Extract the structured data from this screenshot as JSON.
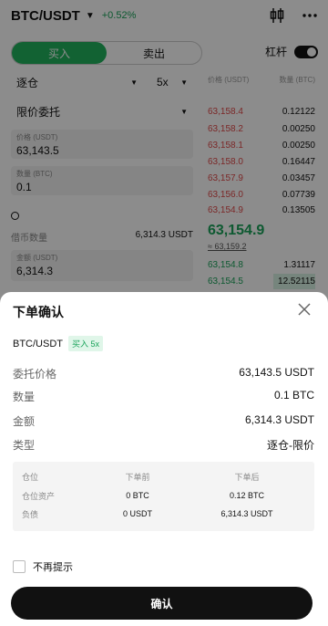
{
  "header": {
    "pair": "BTC/USDT",
    "change": "+0.52%"
  },
  "trade": {
    "tabs": [
      "买入",
      "卖出"
    ],
    "leverage_label": "杠杆",
    "margin_mode": "逐仓",
    "leverage": "5x",
    "order_type": "限价委托",
    "price_label": "价格 (USDT)",
    "price_value": "63,143.5",
    "qty_label": "数量 (BTC)",
    "qty_value": "0.1",
    "avail_label": "借币数量",
    "avail_value": "6,314.3 USDT",
    "amount_label": "金额 (USDT)",
    "amount_value": "6,314.3"
  },
  "orderbook": {
    "price_header": "价格 (USDT)",
    "qty_header": "数量 (BTC)",
    "asks": [
      {
        "price": "63,158.4",
        "qty": "0.12122"
      },
      {
        "price": "63,158.2",
        "qty": "0.00250"
      },
      {
        "price": "63,158.1",
        "qty": "0.00250"
      },
      {
        "price": "63,158.0",
        "qty": "0.16447"
      },
      {
        "price": "63,157.9",
        "qty": "0.03457"
      },
      {
        "price": "63,156.0",
        "qty": "0.07739"
      },
      {
        "price": "63,154.9",
        "qty": "0.13505"
      }
    ],
    "last_price": "63,154.9",
    "mark_price": "≈ 63,159.2",
    "bids": [
      {
        "price": "63,154.8",
        "qty": "1.31117"
      },
      {
        "price": "63,154.5",
        "qty": "12.52115"
      }
    ]
  },
  "modal": {
    "title": "下单确认",
    "pair": "BTC/USDT",
    "side_badge": "买入 5x",
    "rows": [
      {
        "key": "委托价格",
        "value": "63,143.5 USDT"
      },
      {
        "key": "数量",
        "value": "0.1 BTC"
      },
      {
        "key": "金额",
        "value": "6,314.3 USDT"
      },
      {
        "key": "类型",
        "value": "逐仓-限价"
      }
    ],
    "table": {
      "headers": [
        "仓位",
        "下单前",
        "下单后"
      ],
      "rows": [
        [
          "仓位资产",
          "0 BTC",
          "0.12 BTC"
        ],
        [
          "负债",
          "0 USDT",
          "6,314.3 USDT"
        ]
      ]
    },
    "dont_ask": "不再提示",
    "confirm_label": "确认"
  },
  "colors": {
    "green": "#1aa35a",
    "red": "#e04a4a",
    "button": "#111111"
  }
}
